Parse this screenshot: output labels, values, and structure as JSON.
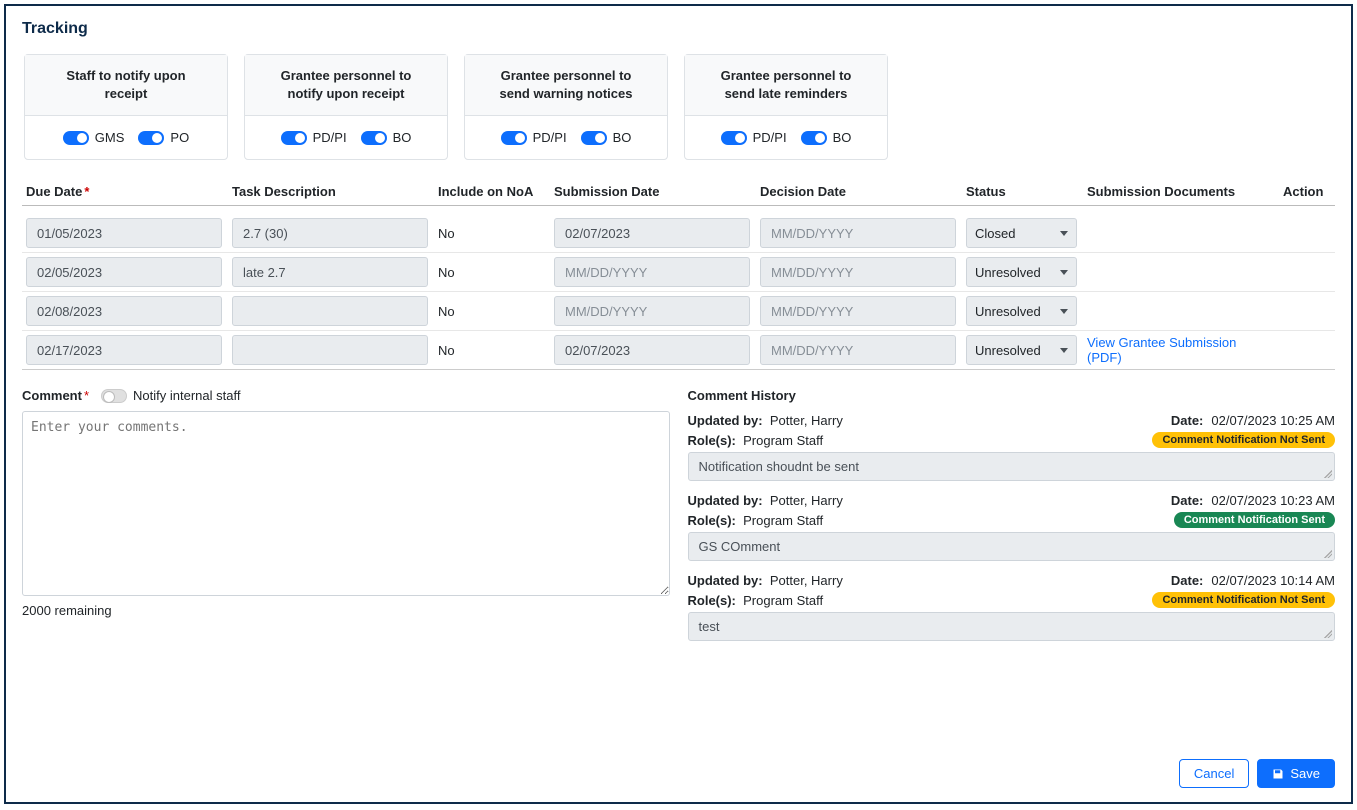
{
  "title": "Tracking",
  "cards": [
    {
      "title": "Staff to notify upon receipt",
      "toggles": [
        {
          "label": "GMS"
        },
        {
          "label": "PO"
        }
      ]
    },
    {
      "title": "Grantee personnel to notify upon receipt",
      "toggles": [
        {
          "label": "PD/PI"
        },
        {
          "label": "BO"
        }
      ]
    },
    {
      "title": "Grantee personnel to send warning notices",
      "toggles": [
        {
          "label": "PD/PI"
        },
        {
          "label": "BO"
        }
      ]
    },
    {
      "title": "Grantee personnel to send late reminders",
      "toggles": [
        {
          "label": "PD/PI"
        },
        {
          "label": "BO"
        }
      ]
    }
  ],
  "columns": {
    "due": "Due Date",
    "task": "Task Description",
    "noa": "Include on NoA",
    "sub": "Submission Date",
    "dec": "Decision Date",
    "status": "Status",
    "docs": "Submission Documents",
    "action": "Action"
  },
  "rows": [
    {
      "due": "01/05/2023",
      "task": "2.7 (30)",
      "noa": "No",
      "sub": "02/07/2023",
      "dec": "",
      "status": "Closed",
      "docs": ""
    },
    {
      "due": "02/05/2023",
      "task": "late 2.7",
      "noa": "No",
      "sub": "",
      "dec": "",
      "status": "Unresolved",
      "docs": ""
    },
    {
      "due": "02/08/2023",
      "task": "",
      "noa": "No",
      "sub": "",
      "dec": "",
      "status": "Unresolved",
      "docs": ""
    },
    {
      "due": "02/17/2023",
      "task": "",
      "noa": "No",
      "sub": "02/07/2023",
      "dec": "",
      "status": "Unresolved",
      "docs": "View Grantee Submission (PDF)"
    }
  ],
  "placeholders": {
    "date": "MM/DD/YYYY",
    "comment": "Enter your comments."
  },
  "comment": {
    "label": "Comment",
    "notify": "Notify internal staff",
    "remaining": "2000 remaining"
  },
  "history": {
    "title": "Comment History",
    "entries": [
      {
        "updated_by": "Potter, Harry",
        "date": "02/07/2023 10:25 AM",
        "roles": "Program Staff",
        "badge": "Comment Notification Not Sent",
        "badge_type": "yellow",
        "text": "Notification shoudnt be sent"
      },
      {
        "updated_by": "Potter, Harry",
        "date": "02/07/2023 10:23 AM",
        "roles": "Program Staff",
        "badge": "Comment Notification Sent",
        "badge_type": "green",
        "text": "GS COmment"
      },
      {
        "updated_by": "Potter, Harry",
        "date": "02/07/2023 10:14 AM",
        "roles": "Program Staff",
        "badge": "Comment Notification Not Sent",
        "badge_type": "yellow",
        "text": "test"
      }
    ]
  },
  "labels": {
    "updated_by": "Updated by:",
    "date": "Date:",
    "roles": "Role(s):"
  },
  "buttons": {
    "cancel": "Cancel",
    "save": "Save"
  }
}
